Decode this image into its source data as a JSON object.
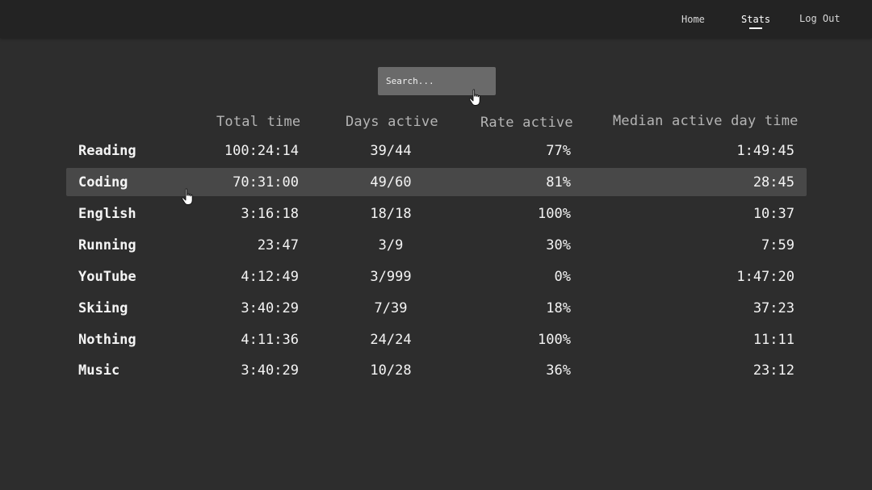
{
  "nav": {
    "home": "Home",
    "stats": "Stats",
    "logout": "Log Out"
  },
  "search": {
    "placeholder": "Search..."
  },
  "table": {
    "headers": [
      "Total time",
      "Days active",
      "Rate active",
      "Median active day time"
    ],
    "rows": [
      {
        "name": "Reading",
        "total": "100:24:14",
        "days": "39/44",
        "rate": "77%",
        "median": "1:49:45"
      },
      {
        "name": "Coding",
        "total": "70:31:00",
        "days": "49/60",
        "rate": "81%",
        "median": "28:45"
      },
      {
        "name": "English",
        "total": "3:16:18",
        "days": "18/18",
        "rate": "100%",
        "median": "10:37"
      },
      {
        "name": "Running",
        "total": "23:47",
        "days": "3/9",
        "rate": "30%",
        "median": "7:59"
      },
      {
        "name": "YouTube",
        "total": "4:12:49",
        "days": "3/999",
        "rate": "0%",
        "median": "1:47:20"
      },
      {
        "name": "Skiing",
        "total": "3:40:29",
        "days": "7/39",
        "rate": "18%",
        "median": "37:23"
      },
      {
        "name": "Nothing",
        "total": "4:11:36",
        "days": "24/24",
        "rate": "100%",
        "median": "11:11"
      },
      {
        "name": "Music",
        "total": "3:40:29",
        "days": "10/28",
        "rate": "36%",
        "median": "23:12"
      }
    ]
  },
  "icons": {
    "cursor_search": "hand-pointer-icon",
    "cursor_row": "hand-pointer-icon"
  },
  "colors": {
    "background": "#2d2d2d",
    "topbar": "#232323",
    "row_highlight": "#484848",
    "search_bg": "#6a6a6a",
    "header_text": "#b5b5b5"
  }
}
